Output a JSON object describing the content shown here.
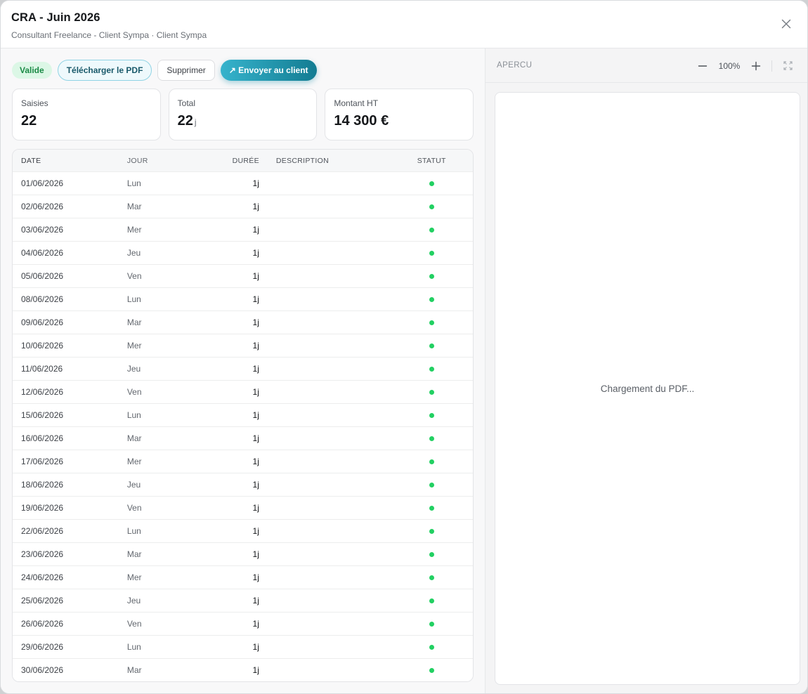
{
  "header": {
    "title": "CRA - Juin 2026",
    "subtitle": "Consultant Freelance - Client Sympa · Client Sympa"
  },
  "actions": {
    "status_badge": "Valide",
    "download_pdf": "Télécharger le PDF",
    "delete": "Supprimer",
    "send_to_client": "↗ Envoyer au client"
  },
  "stats": {
    "saisies": {
      "label": "Saisies",
      "value": "22"
    },
    "total": {
      "label": "Total",
      "value": "22",
      "unit": "j"
    },
    "montant": {
      "label": "Montant HT",
      "value": "14 300 €"
    }
  },
  "table": {
    "columns": {
      "date": "DATE",
      "jour": "JOUR",
      "duree": "DURÉE",
      "description": "DESCRIPTION",
      "statut": "STATUT"
    },
    "status_color": "#22d062",
    "rows": [
      {
        "date": "01/06/2026",
        "jour": "Lun",
        "duree": "1j",
        "description": ""
      },
      {
        "date": "02/06/2026",
        "jour": "Mar",
        "duree": "1j",
        "description": ""
      },
      {
        "date": "03/06/2026",
        "jour": "Mer",
        "duree": "1j",
        "description": ""
      },
      {
        "date": "04/06/2026",
        "jour": "Jeu",
        "duree": "1j",
        "description": ""
      },
      {
        "date": "05/06/2026",
        "jour": "Ven",
        "duree": "1j",
        "description": ""
      },
      {
        "date": "08/06/2026",
        "jour": "Lun",
        "duree": "1j",
        "description": ""
      },
      {
        "date": "09/06/2026",
        "jour": "Mar",
        "duree": "1j",
        "description": ""
      },
      {
        "date": "10/06/2026",
        "jour": "Mer",
        "duree": "1j",
        "description": ""
      },
      {
        "date": "11/06/2026",
        "jour": "Jeu",
        "duree": "1j",
        "description": ""
      },
      {
        "date": "12/06/2026",
        "jour": "Ven",
        "duree": "1j",
        "description": ""
      },
      {
        "date": "15/06/2026",
        "jour": "Lun",
        "duree": "1j",
        "description": ""
      },
      {
        "date": "16/06/2026",
        "jour": "Mar",
        "duree": "1j",
        "description": ""
      },
      {
        "date": "17/06/2026",
        "jour": "Mer",
        "duree": "1j",
        "description": ""
      },
      {
        "date": "18/06/2026",
        "jour": "Jeu",
        "duree": "1j",
        "description": ""
      },
      {
        "date": "19/06/2026",
        "jour": "Ven",
        "duree": "1j",
        "description": ""
      },
      {
        "date": "22/06/2026",
        "jour": "Lun",
        "duree": "1j",
        "description": ""
      },
      {
        "date": "23/06/2026",
        "jour": "Mar",
        "duree": "1j",
        "description": ""
      },
      {
        "date": "24/06/2026",
        "jour": "Mer",
        "duree": "1j",
        "description": ""
      },
      {
        "date": "25/06/2026",
        "jour": "Jeu",
        "duree": "1j",
        "description": ""
      },
      {
        "date": "26/06/2026",
        "jour": "Ven",
        "duree": "1j",
        "description": ""
      },
      {
        "date": "29/06/2026",
        "jour": "Lun",
        "duree": "1j",
        "description": ""
      },
      {
        "date": "30/06/2026",
        "jour": "Mar",
        "duree": "1j",
        "description": ""
      }
    ]
  },
  "preview": {
    "title": "APERCU",
    "zoom_level": "100%",
    "loading_text": "Chargement du PDF..."
  },
  "icons": {
    "close": "close-icon",
    "zoom_out": "minus-icon",
    "zoom_in": "plus-icon",
    "fullscreen": "fullscreen-icon"
  }
}
